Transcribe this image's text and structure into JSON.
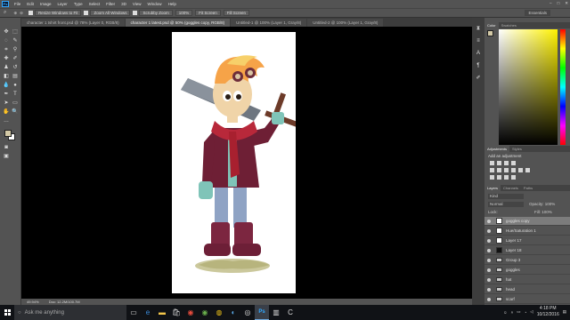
{
  "menubar": {
    "logo": "Ps",
    "items": [
      "File",
      "Edit",
      "Image",
      "Layer",
      "Type",
      "Select",
      "Filter",
      "3D",
      "View",
      "Window",
      "Help"
    ],
    "window_controls": [
      "–",
      "□",
      "✕"
    ]
  },
  "options": {
    "buttons": [
      "Resize Windows to Fit",
      "Zoom All Windows",
      "Scrubby Zoom",
      "100%",
      "Fit Screen",
      "Fill Screen"
    ],
    "workspace": "Essentials"
  },
  "tabs": [
    {
      "label": "character 1 tshirt front.psd @ 78% (Layer 0, RGB/8)"
    },
    {
      "label": "character 1 latest.psd @ 50% (goggles copy, RGB/8)"
    },
    {
      "label": "Untitled-1 @ 100% (Layer 1, Gray/8)"
    },
    {
      "label": "Untitled-2 @ 100% (Layer 1, Gray/8)"
    }
  ],
  "status": {
    "zoom": "49.94%",
    "doc": "Doc: 12.2M/100.7M"
  },
  "panels": {
    "color_tabs": [
      "Color",
      "Swatches"
    ],
    "adjust_tabs": [
      "Adjustments",
      "Styles"
    ],
    "adjust_hint": "Add an adjustment",
    "layers_tabs": [
      "Layers",
      "Channels",
      "Paths"
    ],
    "kind": "Kind",
    "blend": "Normal",
    "opacity": "Opacity: 100%",
    "lock": "Lock:",
    "fill": "Fill: 100%"
  },
  "layers": [
    {
      "name": "goggles copy",
      "thumb": "light",
      "selected": true
    },
    {
      "name": "Hue/Saturation 1",
      "thumb": "light",
      "selected": false
    },
    {
      "name": "Layer 17",
      "thumb": "light",
      "selected": false
    },
    {
      "name": "Layer 18",
      "thumb": "dark",
      "selected": false
    },
    {
      "name": "Group 3",
      "thumb": "folder",
      "selected": false
    },
    {
      "name": "goggles",
      "thumb": "folder",
      "selected": false
    },
    {
      "name": "hat",
      "thumb": "folder",
      "selected": false
    },
    {
      "name": "head",
      "thumb": "folder",
      "selected": false
    },
    {
      "name": "scarf",
      "thumb": "folder",
      "selected": false
    }
  ],
  "taskbar": {
    "search_placeholder": "Ask me anything",
    "time": "4:18 PM",
    "date": "10/12/2016"
  },
  "colors": {
    "fg": "#d3c9a6",
    "hair": "#f6a348",
    "jacket": "#6e1f35",
    "scarf": "#b8283a",
    "skin": "#f0d4a8"
  }
}
